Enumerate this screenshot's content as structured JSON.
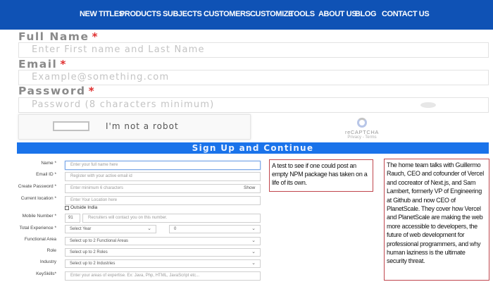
{
  "nav": {
    "items": [
      {
        "label": "NEW TITLES",
        "dropdown": false
      },
      {
        "label": "PRODUCTS",
        "dropdown": true
      },
      {
        "label": "SUBJECTS",
        "dropdown": true
      },
      {
        "label": "CUSTOMERS",
        "dropdown": true
      },
      {
        "label": "CUSTOMIZE",
        "dropdown": false
      },
      {
        "label": "TOOLS",
        "dropdown": false
      },
      {
        "label": "ABOUT US",
        "dropdown": false
      },
      {
        "label": "BLOG",
        "dropdown": false
      },
      {
        "label": "CONTACT US",
        "dropdown": false
      }
    ],
    "chevron": "⌄",
    "bg_color": "#0f52b5"
  },
  "signup": {
    "full_name_label": "Full Name",
    "full_name_placeholder": "Enter First name and Last Name",
    "email_label": "Email",
    "email_placeholder": "Example@something.com",
    "password_label": "Password",
    "password_placeholder": "Password (8 characters minimum)",
    "required_mark": "*",
    "captcha_label": "I'm not a robot",
    "captcha_brand": "reCAPTCHA",
    "captcha_links": "Privacy - Terms",
    "submit_label": "Sign Up and Continue",
    "submit_color": "#1a73ea"
  },
  "registration": {
    "name_label": "Name *",
    "name_placeholder": "Enter your full name here",
    "email_label": "Email ID *",
    "email_placeholder": "Register with your active email id",
    "password_label": "Create Password *",
    "password_placeholder": "Enter minimum 6 characters",
    "show_label": "Show",
    "location_label": "Current location *",
    "location_placeholder": "Enter Your Location here",
    "outside_india_label": "Outside India",
    "mobile_label": "Mobile Number *",
    "country_code": "91",
    "mobile_placeholder": "Recruiters will contact you on this number.",
    "experience_label": "Total Experience *",
    "year_select": "Select Year",
    "month_select": "0",
    "functional_area_label": "Functional Area",
    "functional_area_select": "Select up to 2 Functional Areas",
    "role_label": "Role",
    "role_select": "Select up to 2 Roles",
    "industry_label": "Industry",
    "industry_select": "Select up to 2 Industries",
    "keyskills_label": "KeySkills*",
    "keyskills_placeholder": "Enter your areas of expertise. Ex: Java, Php, HTML, JavaScript etc..."
  },
  "textbox1": {
    "text": "A test to see if one could post an empty NPM package has taken on a life of its own."
  },
  "textbox2": {
    "text": "The home team talks with Guillermo Rauch, CEO and cofounder of Vercel and cocreator of Next.js, and Sam Lambert, formerly VP of Engineering at Github and now CEO of PlanetScale. They cover how Vercel and PlanetScale are making the web more accessible to developers, the future of web development for professional programmers, and why human laziness is the ultimate security threat."
  },
  "colors": {
    "required": "#e03030",
    "textbox_border": "#c0454c"
  }
}
